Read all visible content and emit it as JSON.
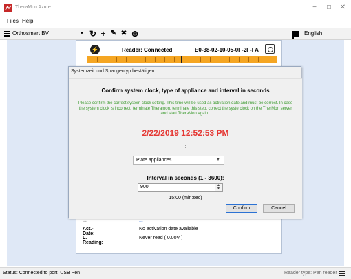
{
  "window": {
    "title": "TheraMon Azure",
    "minimize": "−",
    "maximize": "☐",
    "close": "✕"
  },
  "menu": {
    "items": [
      "Files",
      "Help"
    ]
  },
  "toolbar": {
    "company": "Orthosmart BV",
    "buttons": {
      "refresh": "↻",
      "add": "+",
      "edit": "✎",
      "delete": "✖",
      "web": "⊕"
    },
    "language": "English"
  },
  "reader": {
    "status": "Reader: Connected",
    "id": "E0-38-02-10-05-0F-2F-FA",
    "icon_symbol": "⚡"
  },
  "details": {
    "rows": [
      {
        "label": "...",
        "value": "..."
      },
      {
        "label": "Act.-Date:",
        "value": "No activation date available"
      },
      {
        "label": "L. Reading:",
        "value": "Never read ( 0.00V )"
      }
    ]
  },
  "dialog": {
    "title": "Systemzeit und Spangentyp bestätigen",
    "heading": "Confirm system clock, type of appliance and interval in seconds",
    "instructions": "Please confirm the correct system clock setting. This time will be used as activation date and must be correct. In case the system clock is incorrect, terminate Theramon, terminate this step, correct the syste clock on the TherMon server and start TheraMon again..",
    "datetime": "2/22/2019 12:52:53 PM",
    "separator": ":",
    "appliance_type": "Plate appliances",
    "interval_label": "Interval in seconds (1 - 3600):",
    "interval_value": "900",
    "interval_formatted": "15:00 (min:sec)",
    "confirm_label": "Confirm",
    "cancel_label": "Cancel"
  },
  "statusbar": {
    "left": "Status: Connected to port: USB Pen",
    "right": "Reader type: Pen reader"
  },
  "colors": {
    "accent_orange": "#f5a623",
    "time_red": "#e53935",
    "instruction_green": "#3b9a2e",
    "content_bg": "#dfe8f6"
  }
}
